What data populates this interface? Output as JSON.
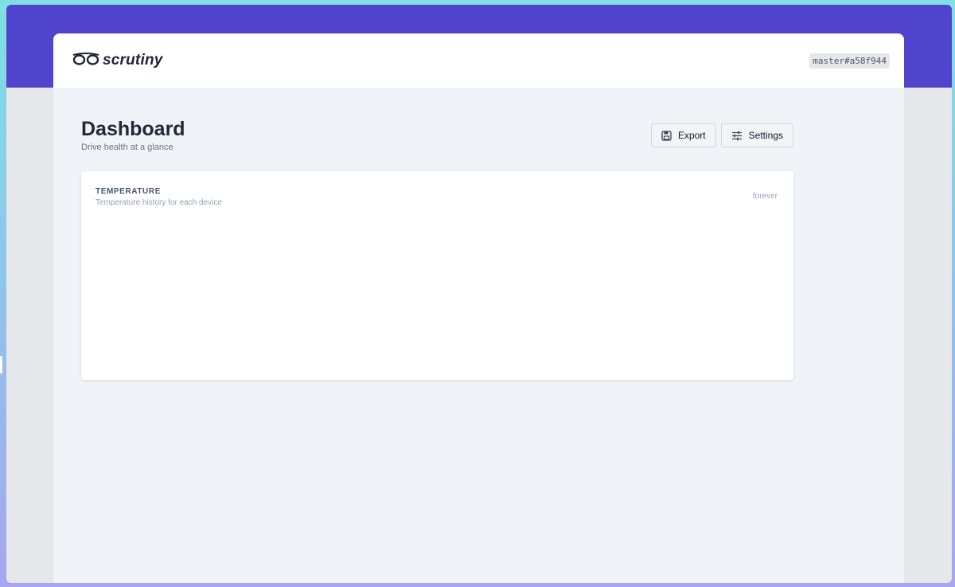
{
  "app": {
    "logo_text": "scrutiny",
    "version": "master#a58f944"
  },
  "page": {
    "title": "Dashboard",
    "subtitle": "Drive health at a glance"
  },
  "actions": {
    "export_label": "Export",
    "settings_label": "Settings"
  },
  "temperature_card": {
    "title": "TEMPERATURE",
    "subtitle": "Temperature history for each device",
    "range": "forever"
  },
  "icons": {
    "logo": "glasses-icon",
    "export": "save-icon",
    "settings": "sliders-icon"
  },
  "colors": {
    "header_band": "#5044cd",
    "page_background": "#f0f3f8"
  }
}
